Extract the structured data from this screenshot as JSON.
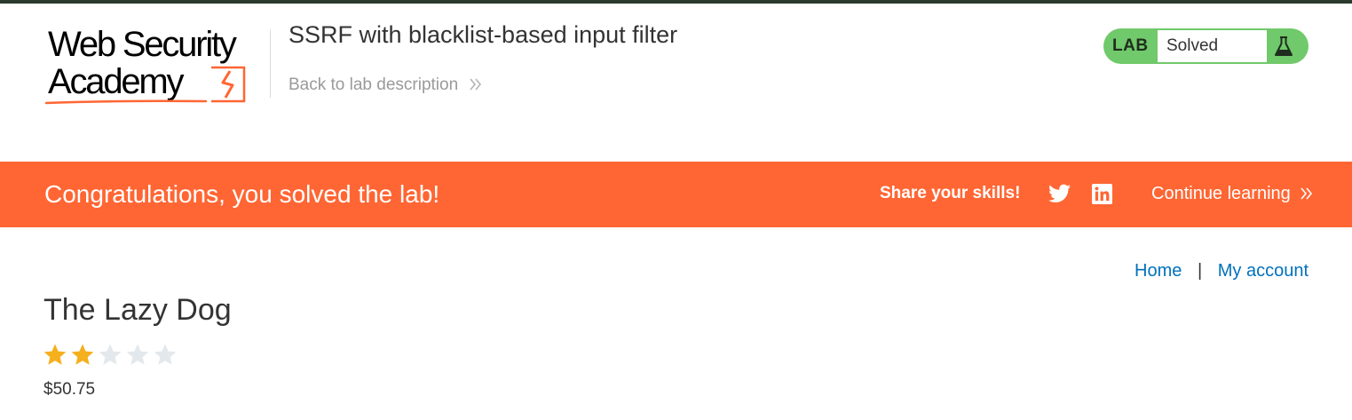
{
  "logo": {
    "line1": "Web Security",
    "line2": "Academy",
    "colors": {
      "text": "#000000",
      "accent": "#ff6633"
    }
  },
  "header": {
    "lab_title": "SSRF with blacklist-based input filter",
    "back_link": "Back to lab description",
    "back_link_icon": "double-chevron-right-icon"
  },
  "status": {
    "label": "LAB",
    "value": "Solved",
    "icon": "flask-icon",
    "color": "#70c96a"
  },
  "banner": {
    "message": "Congratulations, you solved the lab!",
    "share_label": "Share your skills!",
    "social_icons": [
      "twitter-icon",
      "linkedin-icon"
    ],
    "continue_label": "Continue learning",
    "continue_icon": "double-chevron-right-icon",
    "color": "#ff6633"
  },
  "nav": {
    "home": "Home",
    "separator": "|",
    "account": "My account",
    "color": "#0071bc"
  },
  "product": {
    "title": "The Lazy Dog",
    "rating": 2,
    "rating_max": 5,
    "price": "$50.75",
    "star_colors": {
      "filled": "#f5b01e",
      "empty": "#e3e8ec"
    }
  }
}
